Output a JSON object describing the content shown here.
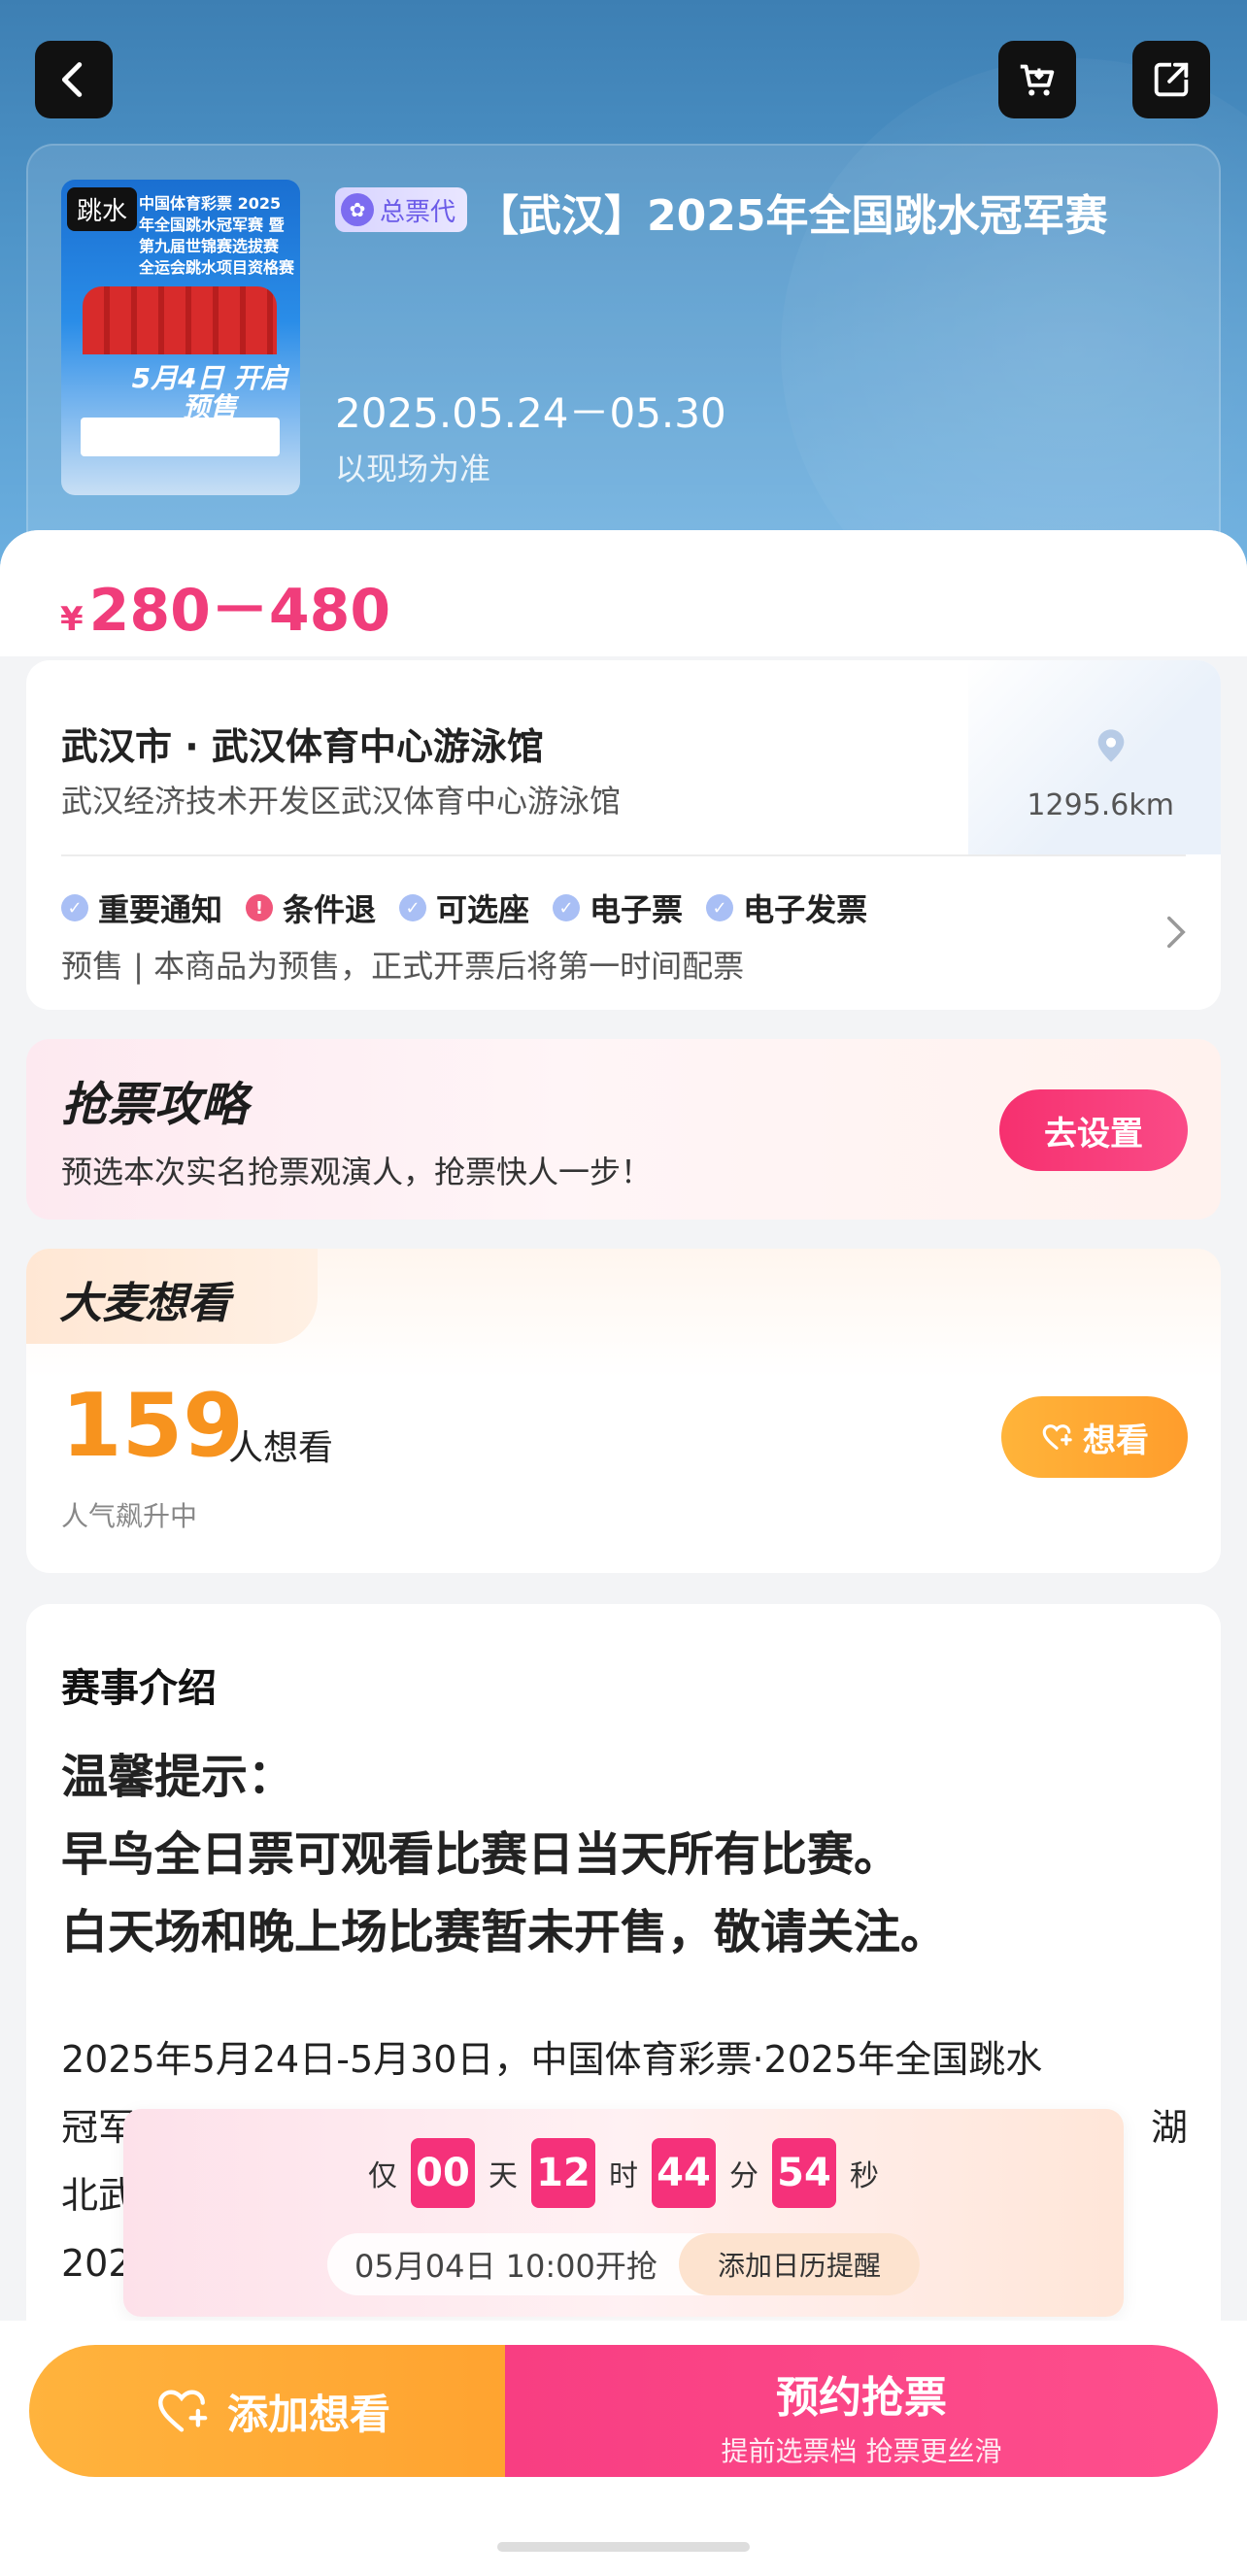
{
  "hero": {
    "poster_tag": "跳水",
    "poster_title": "中国体育彩票 2025年全国跳水冠军赛 暨第九届世锦赛选拔赛 全运会跳水项目资格赛",
    "poster_date": "5月4日 开启预售",
    "agency_badge": "总票代",
    "title": "【武汉】2025年全国跳水冠军赛",
    "date": "2025.05.24－05.30",
    "date_note": "以现场为准"
  },
  "price": {
    "currency": "¥",
    "range": "280－480"
  },
  "venue": {
    "name": "武汉市 · 武汉体育中心游泳馆",
    "address": "武汉经济技术开发区武汉体育中心游泳馆",
    "distance": "1295.6km",
    "tags": [
      {
        "label": "重要通知",
        "icon": "check-icon"
      },
      {
        "label": "条件退",
        "icon": "alert-icon"
      },
      {
        "label": "可选座",
        "icon": "check-icon"
      },
      {
        "label": "电子票",
        "icon": "check-icon"
      },
      {
        "label": "电子发票",
        "icon": "check-icon"
      }
    ],
    "presale": "预售 | 本商品为预售，正式开票后将第一时间配票"
  },
  "strategy": {
    "title": "抢票攻略",
    "subtitle": "预选本次实名抢票观演人，抢票快人一步！",
    "button": "去设置"
  },
  "want": {
    "tab": "大麦想看",
    "count": "159",
    "unit": "人想看",
    "sub": "人气飙升中",
    "button": "想看"
  },
  "intro": {
    "heading": "赛事介绍",
    "tip_lines": [
      "温馨提示：",
      "早鸟全日票可观看比赛日当天所有比赛。",
      "白天场和晚上场比赛暂未开售，敬请关注。"
    ],
    "body_lines": [
      "2025年5月24日-5月30日，中国体育彩票·2025年全国跳水",
      "冠军",
      "北武",
      "202"
    ],
    "body_tail": "湖"
  },
  "countdown": {
    "prefix": "仅",
    "days": "00",
    "days_unit": "天",
    "hours": "12",
    "hours_unit": "时",
    "minutes": "44",
    "minutes_unit": "分",
    "seconds": "54",
    "seconds_unit": "秒",
    "open_time": "05月04日 10:00开抢",
    "calendar_button": "添加日历提醒"
  },
  "footer": {
    "want_button": "添加想看",
    "book_button": "预约抢票",
    "book_sub": "提前选票档 抢票更丝滑"
  },
  "colors": {
    "accent_pink": "#f5317a",
    "accent_orange": "#ffa330",
    "hero_blue": "#4f95c9"
  }
}
